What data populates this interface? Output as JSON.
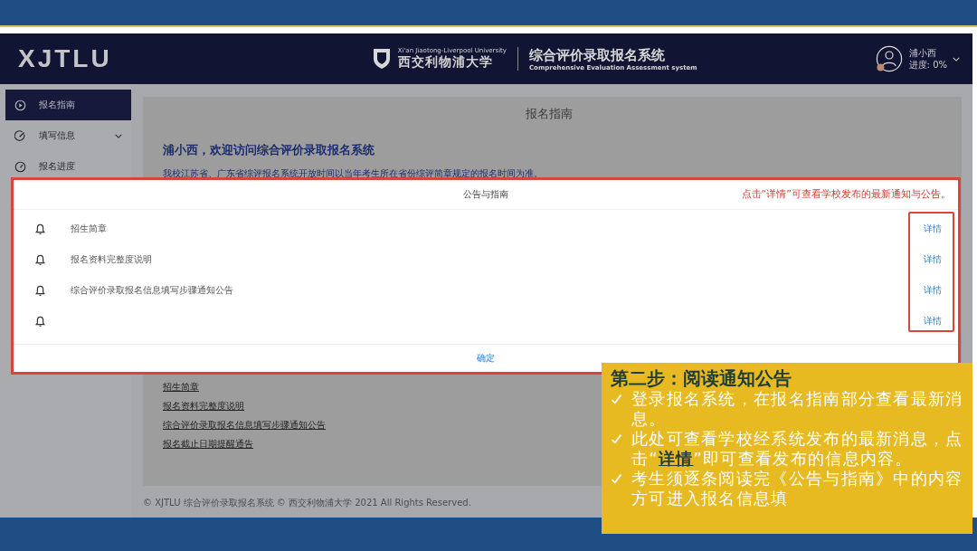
{
  "header": {
    "logo": "XJTLU",
    "university_en": "Xi'an Jiaotong-Liverpool University",
    "university_cn": "西交利物浦大学",
    "system_title": "综合评价录取报名系统",
    "system_subtitle": "Comprehensive Evaluation Assessment system",
    "user_name": "浦小西",
    "progress": "进度: 0%"
  },
  "sidebar": {
    "items": [
      {
        "label": "报名指南",
        "selected": true,
        "kind": "play"
      },
      {
        "label": "填写信息",
        "selected": false,
        "kind": "edit",
        "expanded": false
      },
      {
        "label": "报名进度",
        "selected": false,
        "kind": "gauge"
      }
    ]
  },
  "page": {
    "title": "报名指南",
    "welcome": "浦小西，欢迎访问综合评价录取报名系统",
    "notice": "我校江苏省、广东省综评报名系统开放时间以当年考生所在省份综评简章规定的报名时间为准。",
    "links": [
      {
        "label": "招生简章"
      },
      {
        "label": "报名资料完整度说明"
      },
      {
        "label": "综合评价录取报名信息填写步骤通知公告"
      },
      {
        "label": "报名截止日期提醒通告"
      }
    ],
    "footer": "© XJTLU 综合评价录取报名系统 © 西交利物浦大学 2021 All Rights Reserved."
  },
  "modal": {
    "title": "公告与指南",
    "hint": "点击“详情”可查看学校发布的最新通知与公告。",
    "items": [
      {
        "title": "招生简章",
        "action": "详情"
      },
      {
        "title": "报名资料完整度说明",
        "action": "详情"
      },
      {
        "title": "综合评价录取报名信息填写步骤通知公告",
        "action": "详情"
      },
      {
        "action": "详情"
      }
    ],
    "confirm": "确定"
  },
  "callout": {
    "title": "第二步：阅读通知公告",
    "bullets": [
      "登录报名系统，在报名指南部分查看最新消息。",
      "此处可查看学校经系统发布的最新消息，点击“**详情**”即可查看发布的信息内容。",
      "考生须逐条阅读完《公告与指南》中的内容方可进入报名信息填"
    ]
  }
}
